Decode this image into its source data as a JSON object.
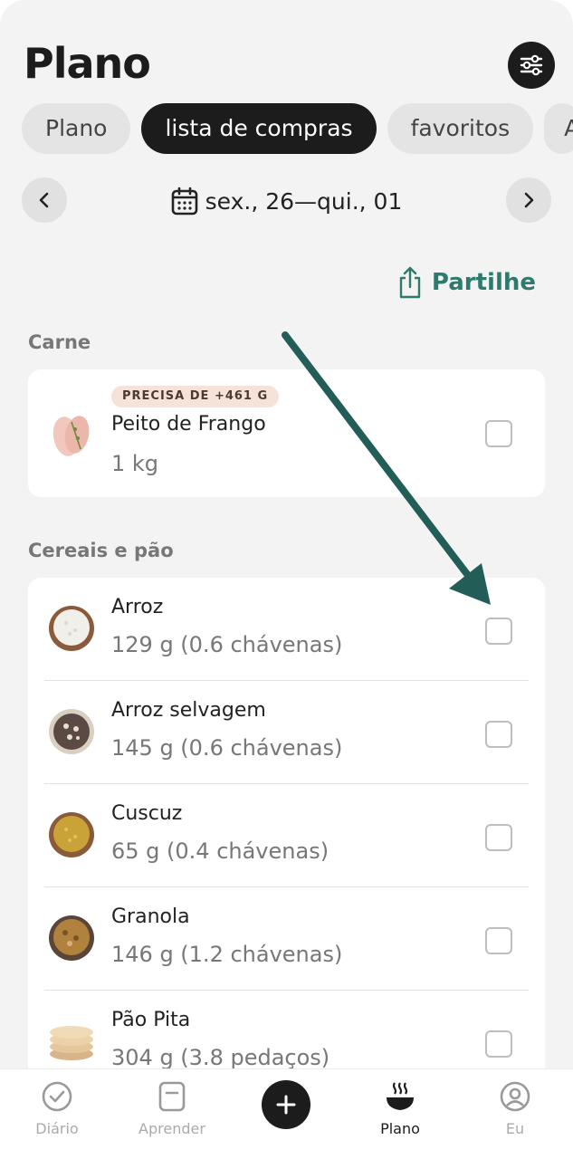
{
  "header": {
    "title": "Plano"
  },
  "tabs": [
    {
      "label": "Plano"
    },
    {
      "label": "lista de compras"
    },
    {
      "label": "favoritos"
    },
    {
      "label": "A"
    }
  ],
  "date_range": {
    "label": "sex., 26—qui., 01"
  },
  "share": {
    "label": "Partilhe"
  },
  "sections": [
    {
      "title": "Carne",
      "items": [
        {
          "badge": "PRECISA DE +461 G",
          "name": "Peito de Frango",
          "qty": "1 kg",
          "icon": "chicken-breast-icon"
        }
      ]
    },
    {
      "title": "Cereais e pão",
      "items": [
        {
          "name": "Arroz",
          "qty": "129 g (0.6 chávenas)",
          "icon": "rice-bowl-icon"
        },
        {
          "name": "Arroz selvagem",
          "qty": "145 g (0.6 chávenas)",
          "icon": "wild-rice-bowl-icon"
        },
        {
          "name": "Cuscuz",
          "qty": "65 g (0.4 chávenas)",
          "icon": "couscous-bowl-icon"
        },
        {
          "name": "Granola",
          "qty": "146 g (1.2 chávenas)",
          "icon": "granola-bowl-icon"
        },
        {
          "name": "Pão Pita",
          "qty": "304 g (3.8 pedaços)",
          "icon": "pita-bread-icon"
        }
      ]
    }
  ],
  "bottom_nav": [
    {
      "label": "Diário",
      "icon": "check-circle-icon"
    },
    {
      "label": "Aprender",
      "icon": "book-icon"
    },
    {
      "label": "Plano",
      "icon": "steaming-bowl-icon"
    },
    {
      "label": "Eu",
      "icon": "user-circle-icon"
    }
  ],
  "colors": {
    "accent": "#2e7a6d",
    "arrow": "#235d57",
    "dark": "#1c1c1c",
    "badge_bg": "#f7e2da"
  }
}
